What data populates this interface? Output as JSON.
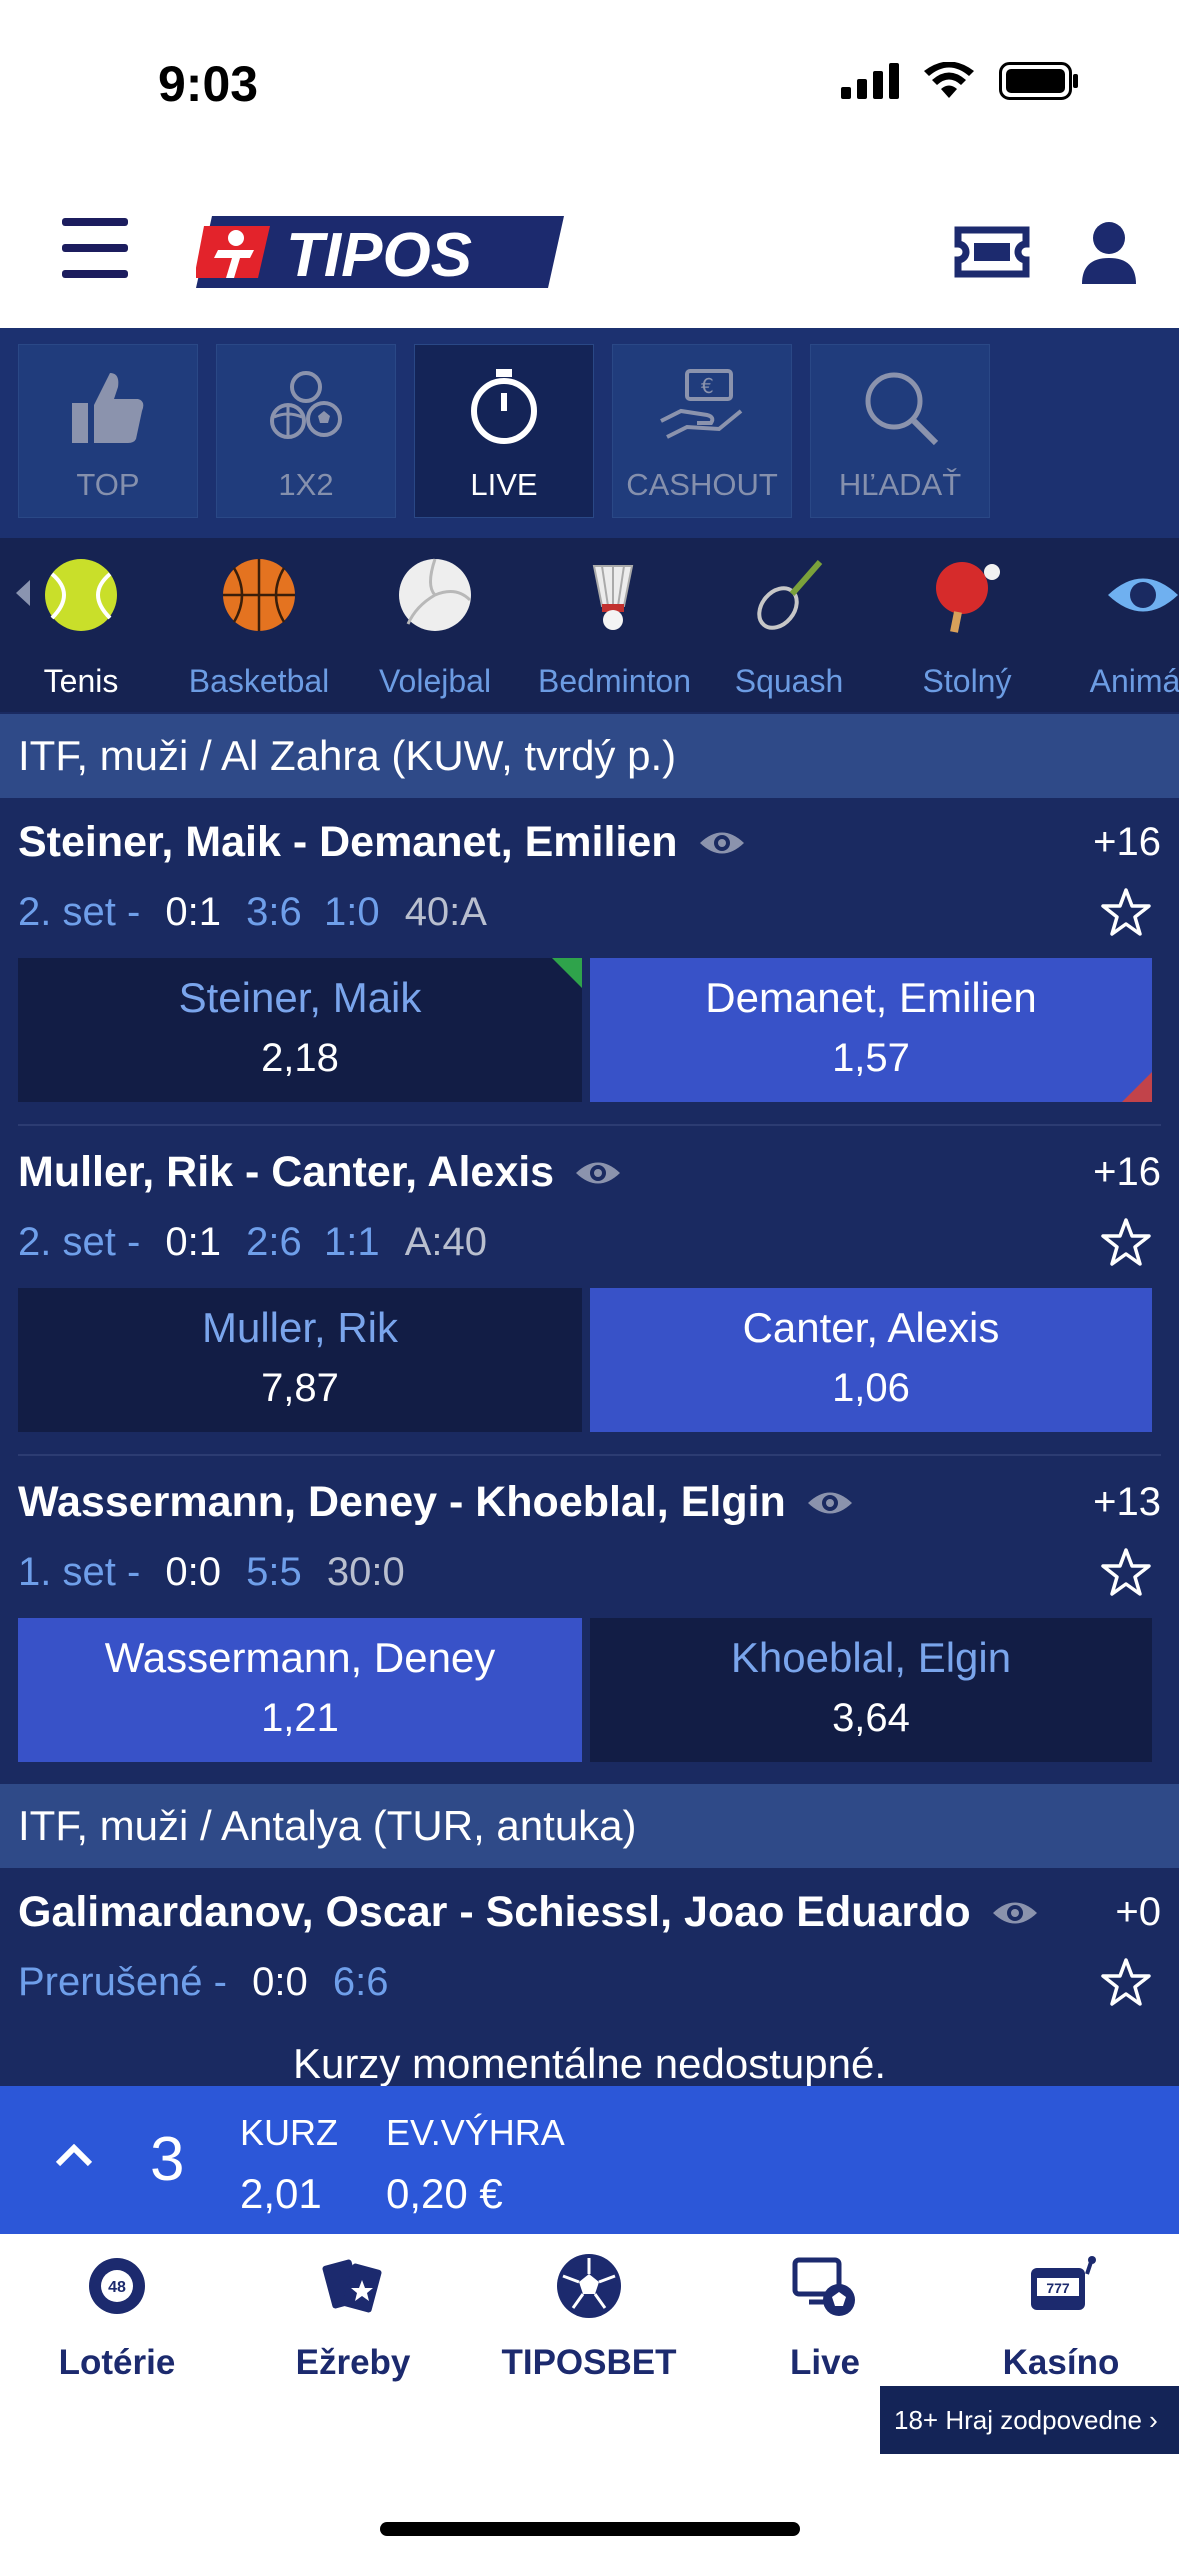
{
  "status": {
    "time": "9:03"
  },
  "logo": {
    "text": "TIPOS"
  },
  "tabs": [
    {
      "label": "TOP",
      "icon": "thumbs-up-icon",
      "active": false
    },
    {
      "label": "1X2",
      "icon": "balls-icon",
      "active": false
    },
    {
      "label": "LIVE",
      "icon": "stopwatch-icon",
      "active": true
    },
    {
      "label": "CASHOUT",
      "icon": "cashout-hand-icon",
      "active": false
    },
    {
      "label": "HĽADAŤ",
      "icon": "search-icon",
      "active": false
    }
  ],
  "sports": [
    {
      "label": "Tenis",
      "icon": "tennis-ball-icon",
      "active": true
    },
    {
      "label": "Basketbal",
      "icon": "basketball-icon",
      "active": false
    },
    {
      "label": "Volejbal",
      "icon": "volleyball-icon",
      "active": false
    },
    {
      "label": "Bedminton",
      "icon": "shuttlecock-icon",
      "active": false
    },
    {
      "label": "Squash",
      "icon": "squash-racket-icon",
      "active": false
    },
    {
      "label": "Stolný",
      "icon": "table-tennis-icon",
      "active": false
    },
    {
      "label": "Animác",
      "icon": "eye-icon",
      "active": false
    }
  ],
  "leagues": [
    {
      "title": "ITF, muži / Al Zahra (KUW, tvrdý p.)"
    },
    {
      "title": "ITF, muži / Antalya (TUR, antuka)"
    }
  ],
  "matches": [
    {
      "title": "Steiner, Maik - Demanet, Emilien",
      "plus": "+16",
      "score": {
        "label": "2. set -",
        "sets": "0:1",
        "games": "3:6  1:0",
        "points": "40:A"
      },
      "odds": [
        {
          "name": "Steiner, Maik",
          "value": "2,18"
        },
        {
          "name": "Demanet, Emilien",
          "value": "1,57"
        }
      ]
    },
    {
      "title": "Muller, Rik - Canter, Alexis",
      "plus": "+16",
      "score": {
        "label": "2. set -",
        "sets": "0:1",
        "games": "2:6  1:1",
        "points": "A:40"
      },
      "odds": [
        {
          "name": "Muller, Rik",
          "value": "7,87"
        },
        {
          "name": "Canter, Alexis",
          "value": "1,06"
        }
      ]
    },
    {
      "title": "Wassermann, Deney - Khoeblal, Elgin",
      "plus": "+13",
      "score": {
        "label": "1. set -",
        "sets": "0:0",
        "games": "5:5",
        "points": "30:0"
      },
      "odds": [
        {
          "name": "Wassermann, Deney",
          "value": "1,21"
        },
        {
          "name": "Khoeblal, Elgin",
          "value": "3,64"
        }
      ]
    },
    {
      "title": "Galimardanov, Oscar - Schiessl, Joao Eduardo",
      "plus": "+0",
      "score": {
        "label": "Prerušené -",
        "sets": "0:0",
        "games": "6:6",
        "points": ""
      },
      "unavailable": "Kurzy momentálne nedostupné."
    }
  ],
  "betslip": {
    "count": "3",
    "kurz_label": "KURZ",
    "kurz_value": "2,01",
    "win_label": "EV.VÝHRA",
    "win_value": "0,20 €"
  },
  "bottom_nav": [
    {
      "label": "Lotérie",
      "icon": "lottery-ball-icon"
    },
    {
      "label": "Ežreby",
      "icon": "scratch-cards-icon"
    },
    {
      "label": "TIPOSBET",
      "icon": "soccer-ball-icon"
    },
    {
      "label": "Live",
      "icon": "live-tv-icon"
    },
    {
      "label": "Kasíno",
      "icon": "slot-machine-icon"
    }
  ],
  "responsible": "18+ Hraj zodpovedne ›",
  "lottery_badge": "48",
  "slot_badge": "777",
  "colors": {
    "navy": "#1a2a61",
    "accent": "#2c57d8",
    "brand_red": "#e3232b"
  }
}
